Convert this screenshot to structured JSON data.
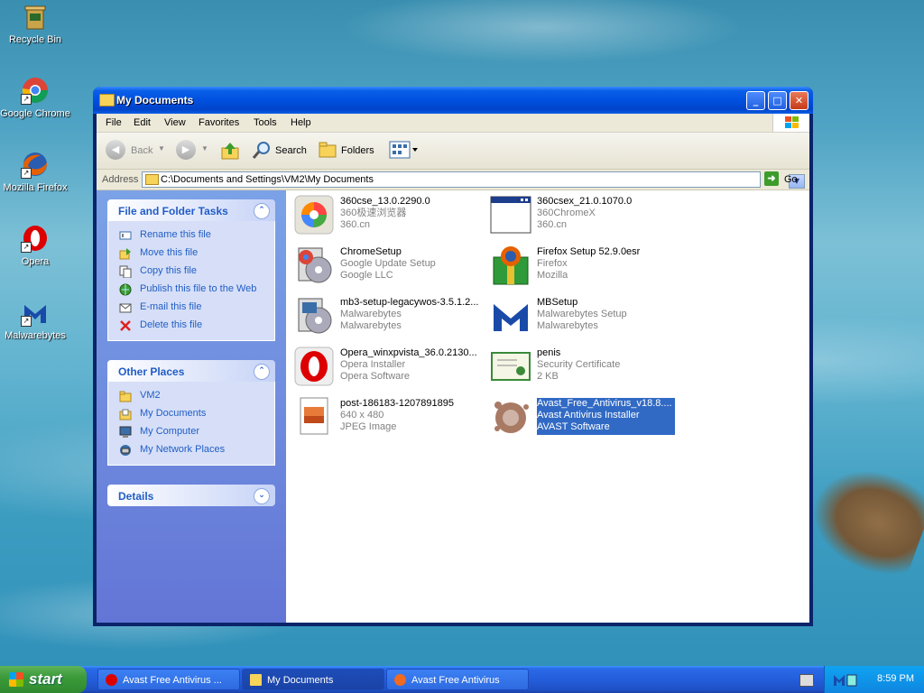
{
  "desktop": {
    "icons": [
      {
        "label": "Recycle Bin",
        "icon": "recycle-bin-icon"
      },
      {
        "label": "Google Chrome",
        "icon": "chrome-icon"
      },
      {
        "label": "Mozilla Firefox",
        "icon": "firefox-icon"
      },
      {
        "label": "Opera",
        "icon": "opera-icon"
      },
      {
        "label": "Malwarebytes",
        "icon": "malwarebytes-icon"
      }
    ]
  },
  "window": {
    "title": "My Documents",
    "menu": [
      "File",
      "Edit",
      "View",
      "Favorites",
      "Tools",
      "Help"
    ],
    "toolbar": {
      "back": "Back",
      "search": "Search",
      "folders": "Folders"
    },
    "address": {
      "label": "Address",
      "path": "C:\\Documents and Settings\\VM2\\My Documents",
      "go": "Go"
    },
    "taskpane": {
      "file_tasks": {
        "title": "File and Folder Tasks",
        "items": [
          "Rename this file",
          "Move this file",
          "Copy this file",
          "Publish this file to the Web",
          "E-mail this file",
          "Delete this file"
        ]
      },
      "other_places": {
        "title": "Other Places",
        "items": [
          "VM2",
          "My Documents",
          "My Computer",
          "My Network Places"
        ]
      },
      "details": {
        "title": "Details"
      }
    },
    "files": [
      {
        "name": "360cse_13.0.2290.0",
        "line2": "360极速浏览器",
        "line3": "360.cn",
        "icon": "360cse-icon"
      },
      {
        "name": "360csex_21.0.1070.0",
        "line2": "360ChromeX",
        "line3": "360.cn",
        "icon": "360csex-icon"
      },
      {
        "name": "ChromeSetup",
        "line2": "Google Update Setup",
        "line3": "Google LLC",
        "icon": "chrome-setup-icon"
      },
      {
        "name": "Firefox Setup 52.9.0esr",
        "line2": "Firefox",
        "line3": "Mozilla",
        "icon": "firefox-setup-icon"
      },
      {
        "name": "mb3-setup-legacywos-3.5.1.2...",
        "line2": "Malwarebytes",
        "line3": "Malwarebytes",
        "icon": "mb3-setup-icon"
      },
      {
        "name": "MBSetup",
        "line2": "Malwarebytes Setup",
        "line3": "Malwarebytes",
        "icon": "mbsetup-icon"
      },
      {
        "name": "Opera_winxpvista_36.0.2130...",
        "line2": "Opera Installer",
        "line3": "Opera Software",
        "icon": "opera-installer-icon"
      },
      {
        "name": "penis",
        "line2": "Security Certificate",
        "line3": "2 KB",
        "icon": "certificate-icon"
      },
      {
        "name": "post-186183-1207891895",
        "line2": "640 x 480",
        "line3": "JPEG Image",
        "icon": "jpeg-image-icon"
      },
      {
        "name": "Avast_Free_Antivirus_v18.8....",
        "line2": "Avast Antivirus Installer",
        "line3": "AVAST Software",
        "icon": "avast-installer-icon",
        "selected": true
      }
    ]
  },
  "taskbar": {
    "start": "start",
    "tasks": [
      {
        "label": "Avast Free Antivirus ...",
        "icon": "opera-icon"
      },
      {
        "label": "My Documents",
        "icon": "folder-icon",
        "active": true
      },
      {
        "label": "Avast Free Antivirus",
        "icon": "avast-icon"
      }
    ],
    "clock": "8:59 PM"
  }
}
